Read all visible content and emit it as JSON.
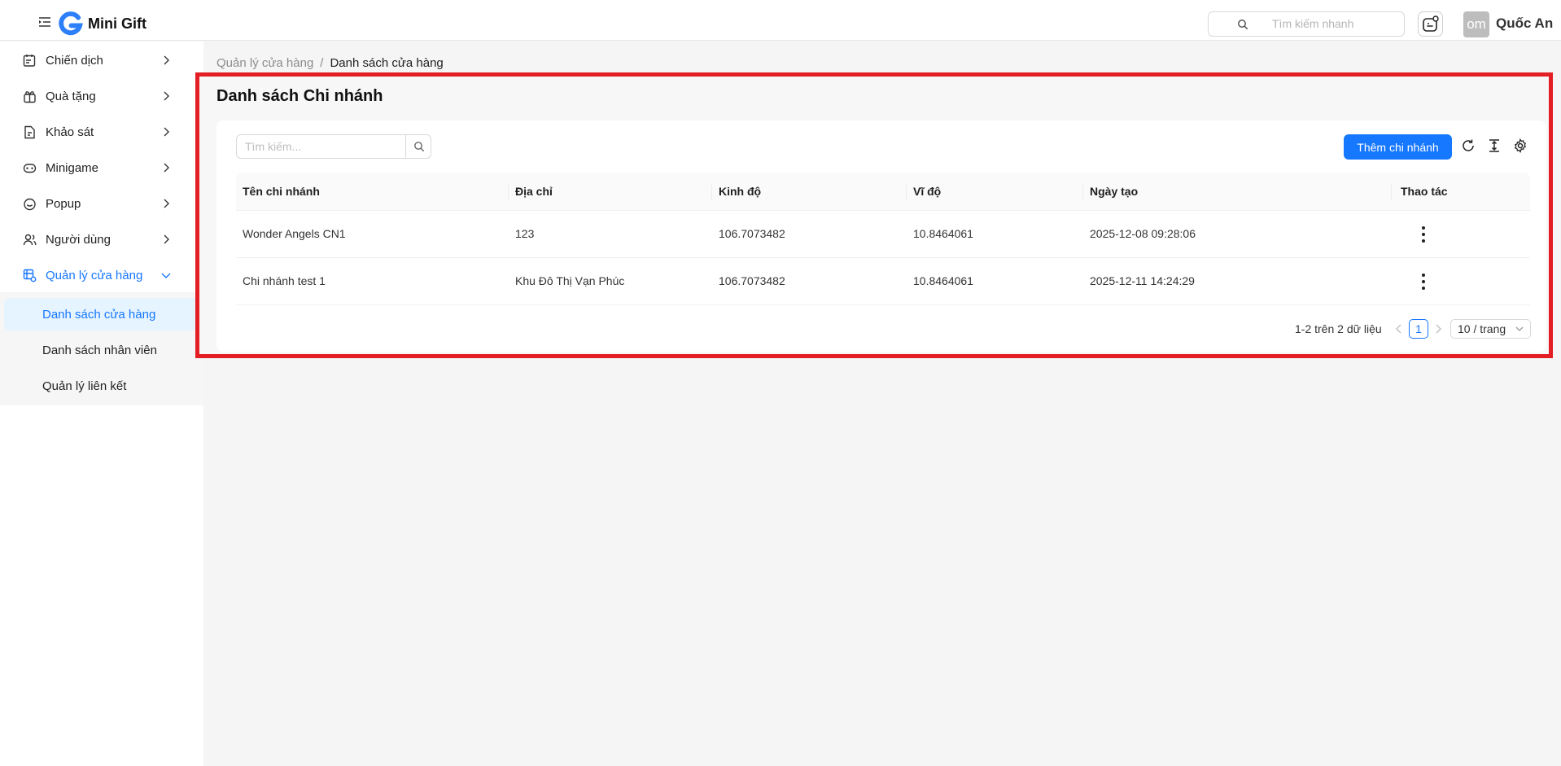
{
  "header": {
    "app_name": "Mini Gift",
    "quick_search_placeholder": "Tìm kiếm nhanh",
    "avatar_initials": "om",
    "user_name": "Quốc An"
  },
  "sidebar": {
    "items": [
      {
        "label": "Chiến dịch"
      },
      {
        "label": "Quà tặng"
      },
      {
        "label": "Khảo sát"
      },
      {
        "label": "Minigame"
      },
      {
        "label": "Popup"
      },
      {
        "label": "Người dùng"
      },
      {
        "label": "Quản lý cửa hàng"
      }
    ],
    "sub_items": [
      {
        "label": "Danh sách cửa hàng"
      },
      {
        "label": "Danh sách nhân viên"
      },
      {
        "label": "Quản lý liên kết"
      }
    ]
  },
  "breadcrumb": {
    "parent": "Quản lý cửa hàng",
    "separator": "/",
    "current": "Danh sách cửa hàng"
  },
  "page": {
    "title": "Danh sách Chi nhánh",
    "search_placeholder": "Tìm kiếm...",
    "add_button": "Thêm chi nhánh"
  },
  "table": {
    "columns": [
      "Tên chi nhánh",
      "Địa chỉ",
      "Kinh độ",
      "Vĩ độ",
      "Ngày tạo",
      "Thao tác"
    ],
    "rows": [
      {
        "name": "Wonder Angels CN1",
        "address": "123",
        "longitude": "106.7073482",
        "latitude": "10.8464061",
        "created": "2025-12-08 09:28:06"
      },
      {
        "name": "Chi nhánh test 1",
        "address": "Khu Đô Thị Vạn Phúc",
        "longitude": "106.7073482",
        "latitude": "10.8464061",
        "created": "2025-12-11 14:24:29"
      }
    ]
  },
  "pagination": {
    "info": "1-2 trên 2 dữ liệu",
    "current_page": "1",
    "page_size": "10 / trang"
  },
  "colors": {
    "primary": "#1677ff",
    "highlight": "#e31e24"
  }
}
